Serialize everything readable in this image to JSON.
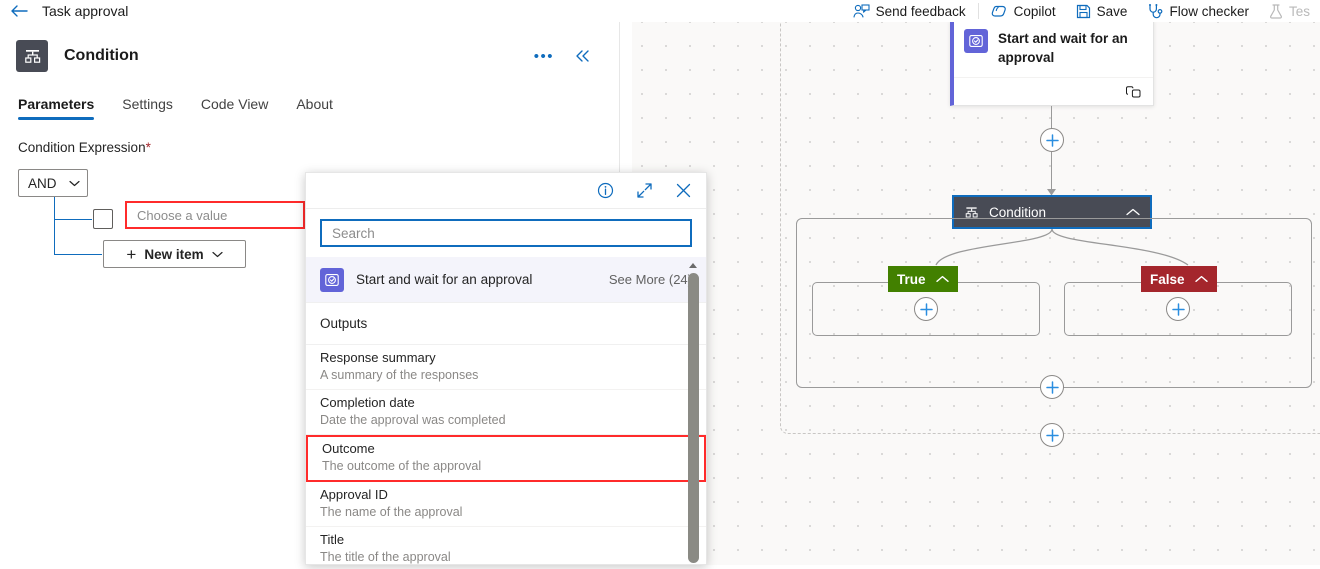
{
  "topbar": {
    "back_icon": "back-arrow-icon",
    "title": "Task approval",
    "commands": [
      {
        "label": "Send feedback",
        "icon": "person-feedback-icon",
        "disabled": false
      },
      {
        "label": "Copilot",
        "icon": "copilot-icon",
        "disabled": false
      },
      {
        "label": "Save",
        "icon": "save-disk-icon",
        "disabled": false
      },
      {
        "label": "Flow checker",
        "icon": "stethoscope-icon",
        "disabled": false
      },
      {
        "label": "Tes",
        "icon": "flask-icon",
        "disabled": true
      }
    ]
  },
  "panel": {
    "node_icon": "condition-branch-icon",
    "title": "Condition",
    "more_icon": "ellipsis-icon",
    "collapse_icon": "double-chevron-left-icon",
    "tabs": [
      {
        "label": "Parameters",
        "active": true
      },
      {
        "label": "Settings",
        "active": false
      },
      {
        "label": "Code View",
        "active": false
      },
      {
        "label": "About",
        "active": false
      }
    ],
    "condition_expression_label": "Condition Expression",
    "required_marker": "*",
    "operator": "AND",
    "operator_chevron": "chevron-down-icon",
    "value_placeholder": "Choose a value",
    "value_kebab_icon": "kebab-menu-icon",
    "new_item_label": "New item",
    "new_item_plus": "+",
    "new_item_chevron": "chevron-down-icon"
  },
  "flyout": {
    "info_icon": "info-circle-icon",
    "expand_icon": "expand-diagonal-icon",
    "close_icon": "close-x-icon",
    "search_placeholder": "Search",
    "group": {
      "icon": "approval-icon",
      "name": "Start and wait for an approval",
      "see_more": "See More",
      "count": "(24)"
    },
    "section_header": "Outputs",
    "items": [
      {
        "title": "Response summary",
        "description": "A summary of the responses",
        "highlighted": false
      },
      {
        "title": "Completion date",
        "description": "Date the approval was completed",
        "highlighted": false
      },
      {
        "title": "Outcome",
        "description": "The outcome of the approval",
        "highlighted": true
      },
      {
        "title": "Approval ID",
        "description": "The name of the approval",
        "highlighted": false
      },
      {
        "title": "Title",
        "description": "The title of the approval",
        "highlighted": false
      }
    ],
    "scroll_up_icon": "scroll-up-arrow-icon"
  },
  "canvas": {
    "approval_node": {
      "icon": "approval-icon",
      "name": "Start and wait for an approval",
      "footer_icon": "copy-icon"
    },
    "condition_node": {
      "icon": "condition-branch-icon",
      "label": "Condition",
      "collapse_chevron": "chevron-up-icon"
    },
    "branches": [
      {
        "label": "True",
        "color": "#428000",
        "chevron": "chevron-up-icon",
        "add_icon": "plus-circle-icon"
      },
      {
        "label": "False",
        "color": "#a4262c",
        "chevron": "chevron-up-icon",
        "add_icon": "plus-circle-icon"
      }
    ],
    "add_buttons": [
      {
        "name": "add-step-above-condition",
        "icon": "plus-circle-icon"
      },
      {
        "name": "add-step-after-condition",
        "icon": "plus-circle-icon"
      },
      {
        "name": "add-step-end",
        "icon": "plus-circle-icon"
      }
    ]
  },
  "colors": {
    "accent_blue": "#0f6cbd",
    "node_dark": "#484b55",
    "approval_purple": "#6264d8",
    "true_green": "#428000",
    "false_red": "#a4262c",
    "highlight_red": "#ff2b2b"
  }
}
